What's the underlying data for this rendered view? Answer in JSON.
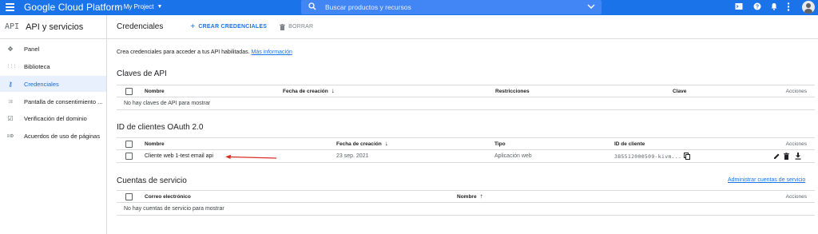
{
  "topbar": {
    "brand": "Google Cloud Platform",
    "project": "My Project",
    "search_placeholder": "Buscar productos y recursos",
    "icons": [
      "terminal-icon",
      "help-icon",
      "notifications-icon",
      "more-vert-icon"
    ]
  },
  "sidebar": {
    "api_badge": "API",
    "title": "API y servicios",
    "items": [
      {
        "label": "Panel",
        "icon": "✥"
      },
      {
        "label": "Biblioteca",
        "icon": "⋮⋮⋮"
      },
      {
        "label": "Credenciales",
        "icon": "⚷",
        "active": true
      },
      {
        "label": "Pantalla de consentimiento ...",
        "icon": "⁝≡"
      },
      {
        "label": "Verificación del dominio",
        "icon": "☑"
      },
      {
        "label": "Acuerdos de uso de páginas",
        "icon": "≡⚙"
      }
    ]
  },
  "page": {
    "title": "Credenciales",
    "create_label": "CREAR CREDENCIALES",
    "delete_label": "BORRAR",
    "intro_text": "Crea credenciales para acceder a tus API habilitadas.",
    "intro_link": "Más información"
  },
  "api_keys": {
    "title": "Claves de API",
    "columns": [
      "Nombre",
      "Fecha de creación",
      "Restricciones",
      "Clave",
      "Acciones"
    ],
    "empty": "No hay claves de API para mostrar"
  },
  "oauth": {
    "title": "ID de clientes OAuth 2.0",
    "columns": [
      "Nombre",
      "Fecha de creación",
      "Tipo",
      "ID de cliente",
      "Acciones"
    ],
    "rows": [
      {
        "name": "Cliente web 1-test email api",
        "date": "23 sep. 2021",
        "type": "Aplicación web",
        "client_id": "385512000509-kivm..."
      }
    ]
  },
  "service_accounts": {
    "title": "Cuentas de servicio",
    "manage_link": "Administrar cuentas de servicio",
    "columns": [
      "Correo electrónico",
      "Nombre",
      "Acciones"
    ],
    "empty": "No hay cuentas de servicio para mostrar"
  },
  "colors": {
    "accent": "#1a73e8",
    "annotation_arrow": "#d93025"
  }
}
